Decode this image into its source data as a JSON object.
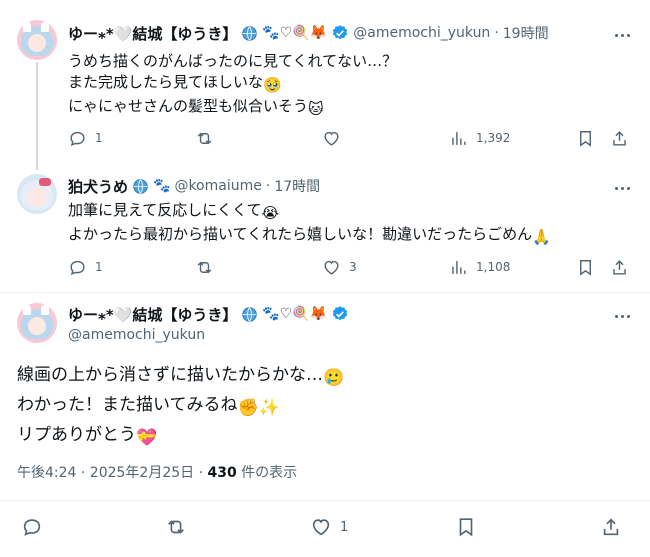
{
  "tweet1": {
    "display_name": "ゆー⁎*🤍結城【ゆうき】",
    "handle": "@amemochi_yukun",
    "time": "19時間",
    "lines": [
      "うめち描くのがんばったのに見てくれてない…？",
      "また完成したら見てほしいな",
      "にゃにゃせさんの髪型も似合いそう"
    ],
    "emoji_after_line2": "🥹",
    "emoji_after_line3": "🐱",
    "name_emojis": "🐾♡🍭🦊",
    "reply_count": "1",
    "like_count": "",
    "views": "1,392"
  },
  "tweet2": {
    "display_name": "狛犬うめ",
    "handle": "@komaiume",
    "time": "17時間",
    "lines": [
      "加筆に見えて反応しにくくて",
      "よかったら最初から描いてくれたら嬉しいな！勘違いだったらごめん"
    ],
    "emoji_after_line1": "😭",
    "emoji_after_line2": "🙏",
    "name_emojis": "🐾",
    "reply_count": "1",
    "like_count": "3",
    "views": "1,108"
  },
  "tweet3": {
    "display_name": "ゆー⁎*🤍結城【ゆうき】",
    "handle": "@amemochi_yukun",
    "name_emojis": "🐾♡🍭🦊",
    "lines": [
      "線画の上から消さずに描いたからかな…",
      "わかった！また描いてみるね",
      "リプありがとう"
    ],
    "emoji_after_line1": "🥲",
    "emoji_after_line2": "✊✨",
    "emoji_after_line3": "💝",
    "timestamp": "午後4:24 · 2025年2月25日 · ",
    "view_count": "430",
    "view_suffix": " 件の表示",
    "like_count": "1"
  },
  "colors": {
    "text": "#0f1419",
    "secondary": "#536471",
    "verified": "#1d9bf0",
    "divider": "#eff3f4"
  }
}
